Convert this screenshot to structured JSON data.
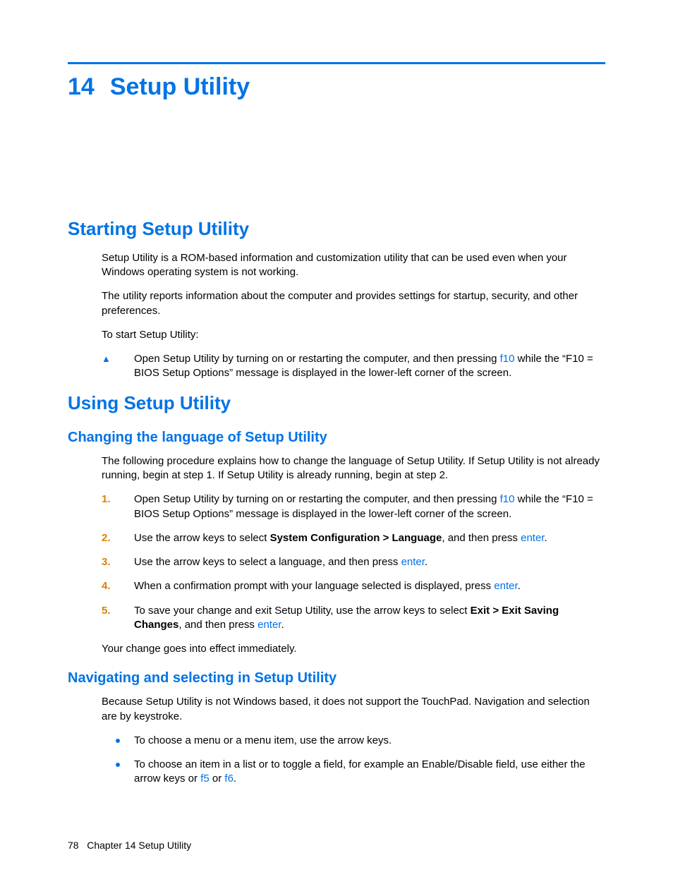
{
  "chapter": {
    "number": "14",
    "title": "Setup Utility"
  },
  "sections": {
    "starting": {
      "heading": "Starting Setup Utility",
      "p1": "Setup Utility is a ROM-based information and customization utility that can be used even when your Windows operating system is not working.",
      "p2": "The utility reports information about the computer and provides settings for startup, security, and other preferences.",
      "p3": "To start Setup Utility:",
      "step": {
        "pre": "Open Setup Utility by turning on or restarting the computer, and then pressing ",
        "key": "f10",
        "post": " while the “F10 = BIOS Setup Options” message is displayed in the lower-left corner of the screen."
      }
    },
    "using": {
      "heading": "Using Setup Utility",
      "lang": {
        "heading": "Changing the language of Setup Utility",
        "intro": "The following procedure explains how to change the language of Setup Utility. If Setup Utility is not already running, begin at step 1. If Setup Utility is already running, begin at step 2.",
        "steps": {
          "s1": {
            "n": "1.",
            "pre": "Open Setup Utility by turning on or restarting the computer, and then pressing ",
            "key": "f10",
            "post": " while the “F10 = BIOS Setup Options” message is displayed in the lower-left corner of the screen."
          },
          "s2": {
            "n": "2.",
            "pre": "Use the arrow keys to select ",
            "bold": "System Configuration > Language",
            "mid": ", and then press ",
            "key": "enter",
            "post": "."
          },
          "s3": {
            "n": "3.",
            "pre": "Use the arrow keys to select a language, and then press ",
            "key": "enter",
            "post": "."
          },
          "s4": {
            "n": "4.",
            "pre": "When a confirmation prompt with your language selected is displayed, press ",
            "key": "enter",
            "post": "."
          },
          "s5": {
            "n": "5.",
            "pre": "To save your change and exit Setup Utility, use the arrow keys to select ",
            "bold": "Exit > Exit Saving Changes",
            "mid": ", and then press ",
            "key": "enter",
            "post": "."
          }
        },
        "outro": "Your change goes into effect immediately."
      },
      "nav": {
        "heading": "Navigating and selecting in Setup Utility",
        "intro": "Because Setup Utility is not Windows based, it does not support the TouchPad. Navigation and selection are by keystroke.",
        "b1": "To choose a menu or a menu item, use the arrow keys.",
        "b2": {
          "pre": "To choose an item in a list or to toggle a field, for example an Enable/Disable field, use either the arrow keys or ",
          "k1": "f5",
          "mid": " or ",
          "k2": "f6",
          "post": "."
        }
      }
    }
  },
  "footer": {
    "page": "78",
    "label": "Chapter 14   Setup Utility"
  }
}
